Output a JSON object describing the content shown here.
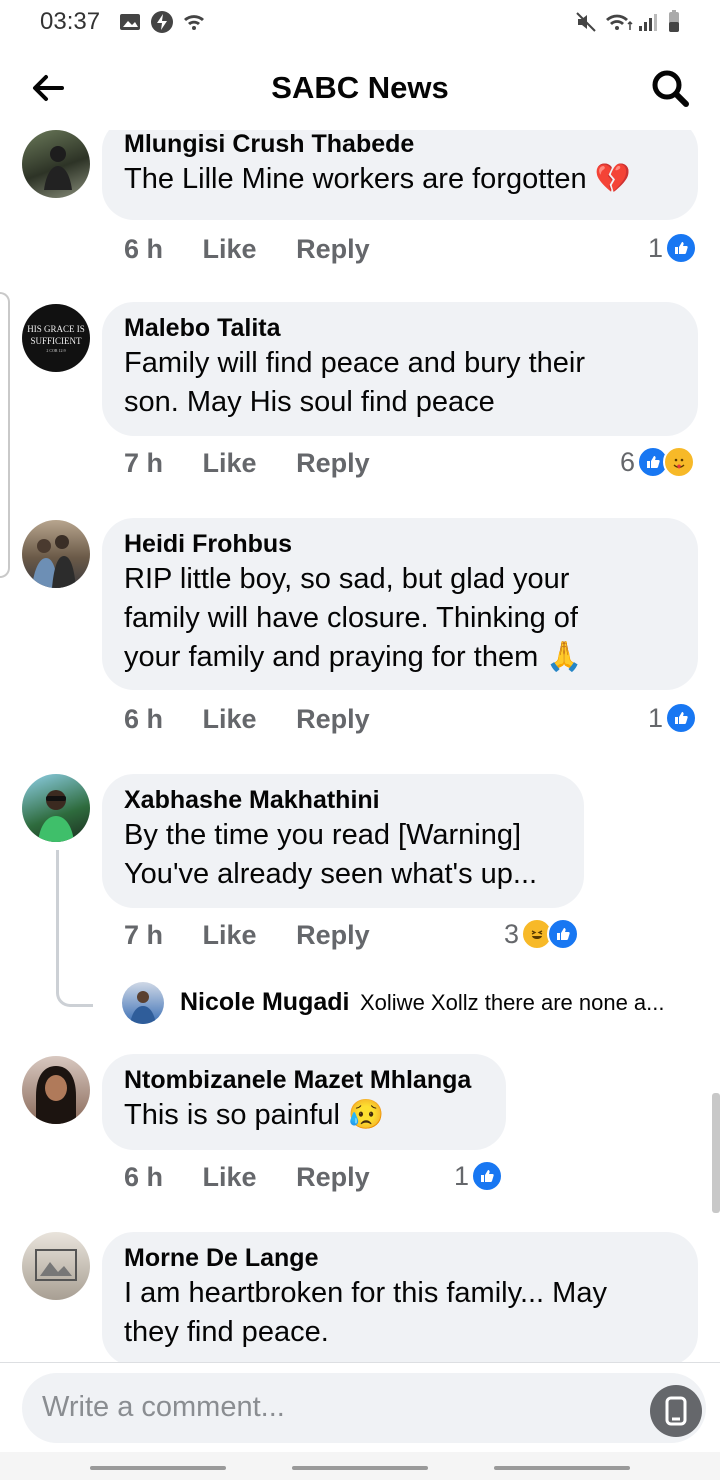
{
  "status": {
    "time": "03:37"
  },
  "header": {
    "title": "SABC News"
  },
  "comments": [
    {
      "name": "Mlungisi Crush  Thabede",
      "lines": [
        "The Lille Mine workers are forgotten 💔"
      ],
      "time": "6 h",
      "like": "Like",
      "reply": "Reply",
      "reaction_count": "1"
    },
    {
      "name": "Malebo Talita",
      "lines": [
        "Family will find peace and bury their",
        "son. May His soul find peace"
      ],
      "time": "7 h",
      "like": "Like",
      "reply": "Reply",
      "reaction_count": "6",
      "avatar_text": [
        "HIS GRACE IS",
        "SUFFICIENT",
        "2 COR 12:9"
      ]
    },
    {
      "name": "Heidi Frohbus",
      "lines": [
        "RIP little boy, so sad, but glad your",
        "family will have closure. Thinking of",
        "your family and praying for them 🙏"
      ],
      "time": "6 h",
      "like": "Like",
      "reply": "Reply",
      "reaction_count": "1"
    },
    {
      "name": "Xabhashe Makhathini",
      "lines": [
        "By the time you read [Warning]",
        "You've already seen what's up..."
      ],
      "time": "7 h",
      "like": "Like",
      "reply": "Reply",
      "reaction_count": "3"
    },
    {
      "name": "Ntombizanele Mazet Mhlanga",
      "lines": [
        "This is so painful 😥"
      ],
      "time": "6 h",
      "like": "Like",
      "reply": "Reply",
      "reaction_count": "1"
    },
    {
      "name": "Morne De Lange",
      "lines": [
        "I am heartbroken for this family... May",
        "they find peace."
      ]
    }
  ],
  "reply_preview": {
    "name": "Nicole Mugadi",
    "text": "Xoliwe Xollz there are none a..."
  },
  "composer": {
    "placeholder": "Write a comment..."
  },
  "colors": {
    "like_blue": "#1877f2",
    "bubble": "#f0f2f5",
    "meta": "#65676b"
  }
}
